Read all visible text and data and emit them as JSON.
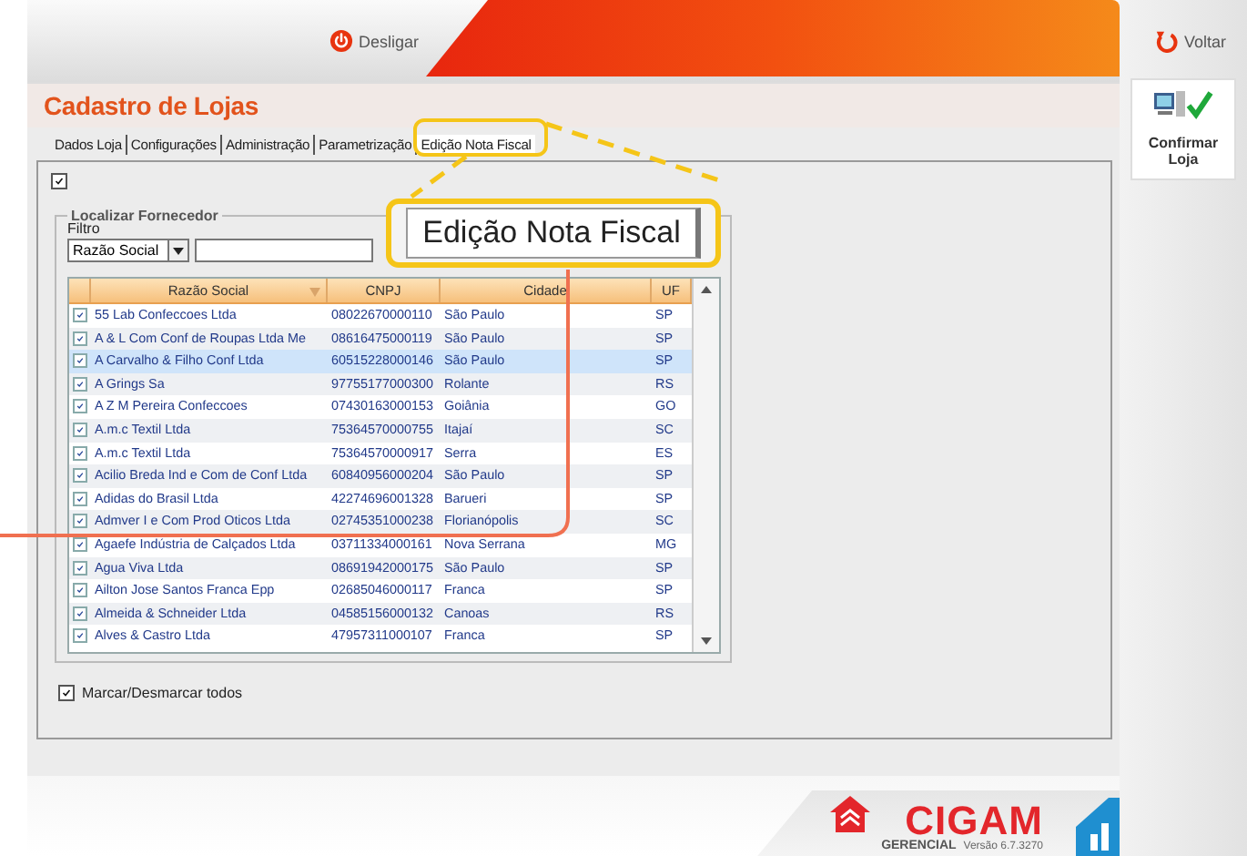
{
  "header": {
    "logout": "Desligar",
    "back": "Voltar"
  },
  "side_actions": [
    {
      "label": "Confirmar Loja"
    }
  ],
  "page_title": "Cadastro de Lojas",
  "tabs": [
    {
      "label": "Dados Loja",
      "selected": false
    },
    {
      "label": "Configurações",
      "selected": false
    },
    {
      "label": "Administração",
      "selected": false
    },
    {
      "label": "Parametrização",
      "selected": false
    },
    {
      "label": "Edição Nota Fiscal",
      "selected": true
    }
  ],
  "top_checkbox": {
    "checked": true
  },
  "search_group": {
    "title": "Localizar Fornecedor",
    "filter_label": "Filtro",
    "filter_value": "Razão Social"
  },
  "table": {
    "columns": [
      "Razão Social",
      "CNPJ",
      "Cidade",
      "UF"
    ],
    "rows": [
      {
        "checked": true,
        "selected": false,
        "cells": [
          "55 Lab Confeccoes Ltda",
          "08022670000110",
          "São Paulo",
          "SP"
        ]
      },
      {
        "checked": true,
        "selected": false,
        "cells": [
          "A & L Com Conf de Roupas Ltda Me",
          "08616475000119",
          "São Paulo",
          "SP"
        ]
      },
      {
        "checked": true,
        "selected": true,
        "cells": [
          "A Carvalho & Filho Conf Ltda",
          "60515228000146",
          "São Paulo",
          "SP"
        ]
      },
      {
        "checked": true,
        "selected": false,
        "cells": [
          "A Grings Sa",
          "97755177000300",
          "Rolante",
          "RS"
        ]
      },
      {
        "checked": true,
        "selected": false,
        "cells": [
          "A Z M Pereira Confeccoes",
          "07430163000153",
          "Goiânia",
          "GO"
        ]
      },
      {
        "checked": true,
        "selected": false,
        "cells": [
          "A.m.c Textil Ltda",
          "75364570000755",
          "Itajaí",
          "SC"
        ]
      },
      {
        "checked": true,
        "selected": false,
        "cells": [
          "A.m.c Textil Ltda",
          "75364570000917",
          "Serra",
          "ES"
        ]
      },
      {
        "checked": true,
        "selected": false,
        "cells": [
          "Acilio Breda Ind e Com de Conf Ltda",
          "60840956000204",
          "São Paulo",
          "SP"
        ]
      },
      {
        "checked": true,
        "selected": false,
        "cells": [
          "Adidas do Brasil Ltda",
          "42274696001328",
          "Barueri",
          "SP"
        ]
      },
      {
        "checked": true,
        "selected": false,
        "cells": [
          "Admver I e Com Prod Oticos Ltda",
          "02745351000238",
          "Florianópolis",
          "SC"
        ]
      },
      {
        "checked": true,
        "selected": false,
        "cells": [
          "Agaefe Indústria de Calçados Ltda",
          "03711334000161",
          "Nova Serrana",
          "MG"
        ]
      },
      {
        "checked": true,
        "selected": false,
        "cells": [
          "Agua Viva Ltda",
          "08691942000175",
          "São Paulo",
          "SP"
        ]
      },
      {
        "checked": true,
        "selected": false,
        "cells": [
          "Ailton Jose Santos Franca Epp",
          "02685046000117",
          "Franca",
          "SP"
        ]
      },
      {
        "checked": true,
        "selected": false,
        "cells": [
          "Almeida & Schneider Ltda",
          "04585156000132",
          "Canoas",
          "RS"
        ]
      },
      {
        "checked": true,
        "selected": false,
        "cells": [
          "Alves & Castro Ltda",
          "47957311000107",
          "Franca",
          "SP"
        ]
      }
    ]
  },
  "select_all": {
    "label": "Marcar/Desmarcar todos",
    "checked": true
  },
  "callout": {
    "text": "Edição Nota Fiscal"
  },
  "footer": {
    "brand": "CIGAM",
    "edition": "GERENCIAL",
    "version": "Versão 6.7.3270"
  }
}
